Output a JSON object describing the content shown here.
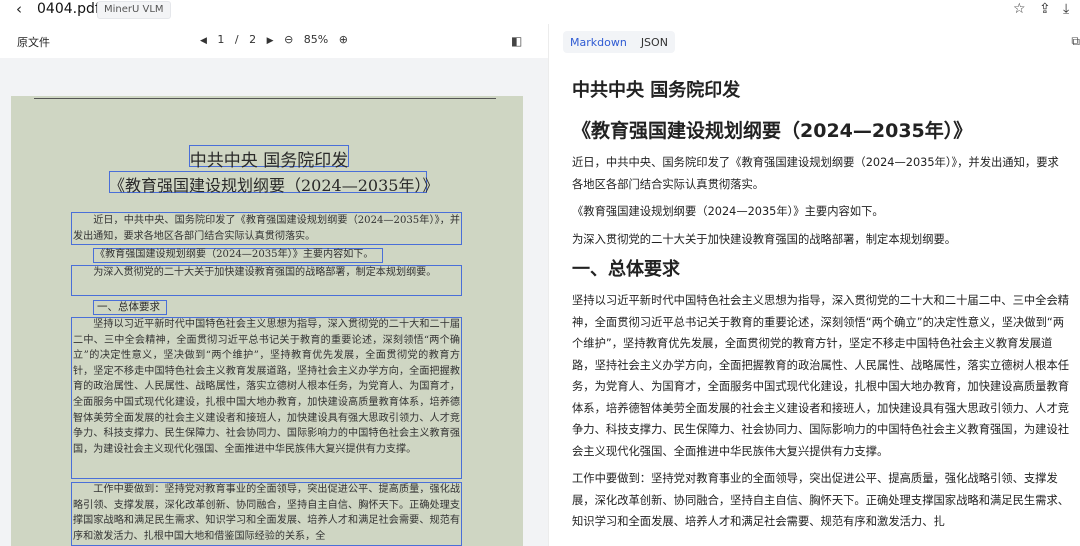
{
  "topbar": {
    "back_icon": "‹",
    "filename": "0404.pdf",
    "badge": "MinerU VLM",
    "star_icon": "☆",
    "share_icon": "⇪",
    "download_icon": "⤓"
  },
  "left_toolbar": {
    "title": "原文件",
    "prev_icon": "◀",
    "page_current": "1",
    "page_sep": "/",
    "page_total": "2",
    "next_icon": "▶",
    "zoom_out_icon": "⊖",
    "zoom": "85%",
    "zoom_in_icon": "⊕",
    "sidebar_icon": "◧"
  },
  "scan": {
    "title1": "中共中央 国务院印发",
    "title2": "《教育强国建设规划纲要（2024—2035年）》",
    "p1": "近日，中共中央、国务院印发了《教育强国建设规划纲要（2024—2035年）》，并发出通知，要求各地区各部门结合实际认真贯彻落实。",
    "p2": "《教育强国建设规划纲要（2024—2035年）》主要内容如下。",
    "p3": "为深入贯彻党的二十大关于加快建设教育强国的战略部署，制定本规划纲要。",
    "heading": "一、总体要求",
    "p4": "坚持以习近平新时代中国特色社会主义思想为指导，深入贯彻党的二十大和二十届二中、三中全会精神，全面贯彻习近平总书记关于教育的重要论述，深刻领悟“两个确立”的决定性意义，坚决做到“两个维护”，坚持教育优先发展，全面贯彻党的教育方针，坚定不移走中国特色社会主义教育发展道路，坚持社会主义办学方向，全面把握教育的政治属性、人民属性、战略属性，落实立德树人根本任务，为党育人、为国育才，全面服务中国式现代化建设，扎根中国大地办教育，加快建设高质量教育体系，培养德智体美劳全面发展的社会主义建设者和接班人，加快建设具有强大思政引领力、人才竞争力、科技支撑力、民生保障力、社会协同力、国际影响力的中国特色社会主义教育强国，为建设社会主义现代化强国、全面推进中华民族伟大复兴提供有力支撑。",
    "p5": "工作中要做到：坚持党对教育事业的全面领导，突出促进公平、提高质量，强化战略引领、支撑发展，深化改革创新、协同融合，坚持自主自信、胸怀天下。正确处理支撑国家战略和满足民生需求、知识学习和全面发展、培养人才和满足社会需要、规范有序和激发活力、扎根中国大地和借鉴国际经验的关系，全"
  },
  "right_toolbar": {
    "tab_markdown": "Markdown",
    "tab_json": "JSON",
    "copy_icon": "⧉"
  },
  "markdown": {
    "h1": "中共中央 国务院印发",
    "h1b": "《教育强国建设规划纲要（2024—2035年）》",
    "p1": "近日，中共中央、国务院印发了《教育强国建设规划纲要（2024—2035年）》，并发出通知，要求各地区各部门结合实际认真贯彻落实。",
    "p2": "《教育强国建设规划纲要（2024—2035年）》主要内容如下。",
    "p3": "为深入贯彻党的二十大关于加快建设教育强国的战略部署，制定本规划纲要。",
    "h2": "一、总体要求",
    "p4": "坚持以习近平新时代中国特色社会主义思想为指导，深入贯彻党的二十大和二十届二中、三中全会精神，全面贯彻习近平总书记关于教育的重要论述，深刻领悟“两个确立”的决定性意义，坚决做到“两个维护”，坚持教育优先发展，全面贯彻党的教育方针，坚定不移走中国特色社会主义教育发展道路，坚持社会主义办学方向，全面把握教育的政治属性、人民属性、战略属性，落实立德树人根本任务，为党育人、为国育才，全面服务中国式现代化建设，扎根中国大地办教育，加快建设高质量教育体系，培养德智体美劳全面发展的社会主义建设者和接班人，加快建设具有强大思政引领力、人才竞争力、科技支撑力、民生保障力、社会协同力、国际影响力的中国特色社会主义教育强国，为建设社会主义现代化强国、全面推进中华民族伟大复兴提供有力支撑。",
    "p5": "工作中要做到：坚持党对教育事业的全面领导，突出促进公平、提高质量，强化战略引领、支撑发展，深化改革创新、协同融合，坚持自主自信、胸怀天下。正确处理支撑国家战略和满足民生需求、知识学习和全面发展、培养人才和满足社会需要、规范有序和激发活力、扎"
  }
}
